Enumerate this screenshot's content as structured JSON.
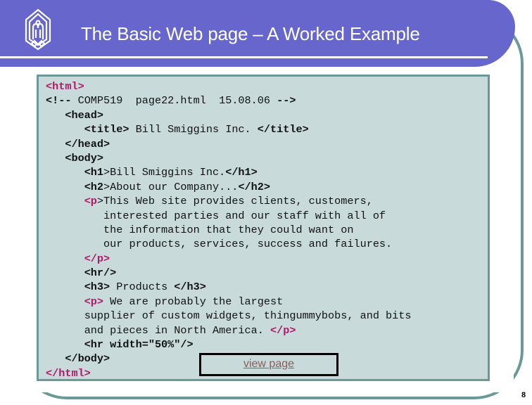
{
  "slide": {
    "title": "The Basic Web page – A Worked Example",
    "page_number": "8",
    "logo_icon": "arch-emblem-icon",
    "colors": {
      "header_bg": "#6666cc",
      "frame": "#6b9999",
      "code_bg": "#c8dada",
      "tag_accent": "#b0186a",
      "link": "#8a5c5c"
    }
  },
  "code": {
    "lines": [
      {
        "indent": "",
        "segments": [
          {
            "text": "<html>",
            "style": "accent"
          }
        ]
      },
      {
        "indent": "",
        "segments": [
          {
            "text": "<!--",
            "style": "tag"
          },
          {
            "text": " COMP519  page22.html  15.08.06 ",
            "style": "plain"
          },
          {
            "text": "-->",
            "style": "tag"
          }
        ]
      },
      {
        "indent": "   ",
        "segments": [
          {
            "text": "<head>",
            "style": "tag"
          }
        ]
      },
      {
        "indent": "      ",
        "segments": [
          {
            "text": "<title>",
            "style": "tag"
          },
          {
            "text": " Bill Smiggins Inc. ",
            "style": "plain"
          },
          {
            "text": "</title>",
            "style": "tag"
          }
        ]
      },
      {
        "indent": "   ",
        "segments": [
          {
            "text": "</head>",
            "style": "tag"
          }
        ]
      },
      {
        "indent": "   ",
        "segments": [
          {
            "text": "<body>",
            "style": "tag"
          }
        ]
      },
      {
        "indent": "      ",
        "segments": [
          {
            "text": "<h1",
            "style": "tag"
          },
          {
            "text": ">Bill Smiggins Inc.",
            "style": "plain"
          },
          {
            "text": "</h1>",
            "style": "tag"
          }
        ]
      },
      {
        "indent": "      ",
        "segments": [
          {
            "text": "<h2",
            "style": "tag"
          },
          {
            "text": ">About our Company...",
            "style": "plain"
          },
          {
            "text": "</h2>",
            "style": "tag"
          }
        ]
      },
      {
        "indent": "      ",
        "segments": [
          {
            "text": "<p",
            "style": "accent"
          },
          {
            "text": ">This Web site provides clients, customers,",
            "style": "plain"
          }
        ]
      },
      {
        "indent": "         ",
        "segments": [
          {
            "text": "interested parties and our staff with all of",
            "style": "plain"
          }
        ]
      },
      {
        "indent": "         ",
        "segments": [
          {
            "text": "the information that they could want on",
            "style": "plain"
          }
        ]
      },
      {
        "indent": "         ",
        "segments": [
          {
            "text": "our products, services, success and failures.",
            "style": "plain"
          }
        ]
      },
      {
        "indent": "      ",
        "segments": [
          {
            "text": "</p>",
            "style": "accent"
          }
        ]
      },
      {
        "indent": "      ",
        "segments": [
          {
            "text": "<hr/>",
            "style": "tag"
          }
        ]
      },
      {
        "indent": "      ",
        "segments": [
          {
            "text": "<h3>",
            "style": "tag"
          },
          {
            "text": " Products ",
            "style": "plain"
          },
          {
            "text": "</h3>",
            "style": "tag"
          }
        ]
      },
      {
        "indent": "      ",
        "segments": [
          {
            "text": "<p>",
            "style": "accent"
          },
          {
            "text": " We are probably the largest",
            "style": "plain"
          }
        ]
      },
      {
        "indent": "      ",
        "segments": [
          {
            "text": "supplier of custom widgets, thingummybobs, and bits",
            "style": "plain"
          }
        ]
      },
      {
        "indent": "      ",
        "segments": [
          {
            "text": "and pieces in North America. ",
            "style": "plain"
          },
          {
            "text": "</p>",
            "style": "accent"
          }
        ]
      },
      {
        "indent": "      ",
        "segments": [
          {
            "text": "<hr width=\"50%\"/>",
            "style": "tag"
          }
        ]
      },
      {
        "indent": "   ",
        "segments": [
          {
            "text": "</body>",
            "style": "tag"
          }
        ]
      },
      {
        "indent": "",
        "segments": [
          {
            "text": "</html>",
            "style": "accent"
          }
        ]
      }
    ]
  },
  "view_page": {
    "label": "view page"
  }
}
